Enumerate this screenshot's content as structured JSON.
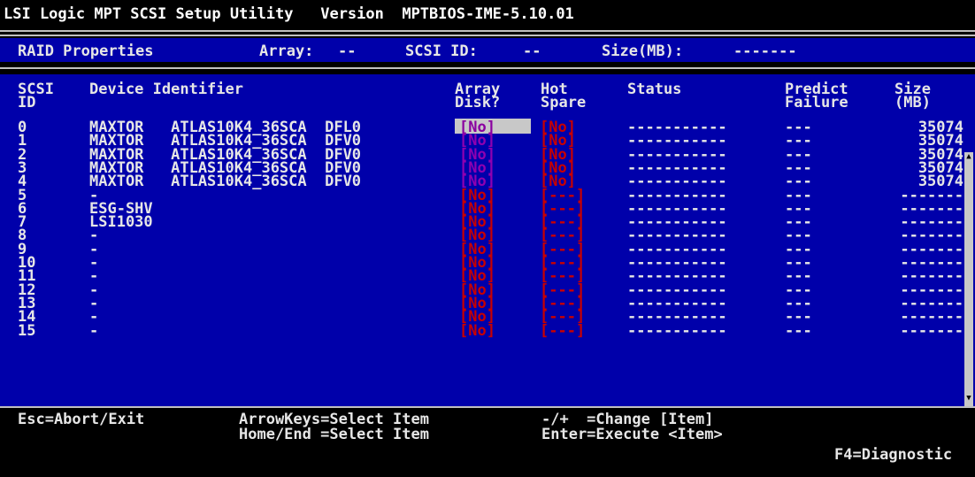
{
  "title": "LSI Logic MPT SCSI Setup Utility   Version  MPTBIOS-IME-5.10.01",
  "header": {
    "section": "RAID Properties",
    "array_label": "Array:",
    "array_value": "--",
    "scsi_id_label": "SCSI ID:",
    "scsi_id_value": "--",
    "size_label": "Size(MB):",
    "size_value": "-------"
  },
  "columns": {
    "scsi_id": [
      "SCSI",
      "ID"
    ],
    "device": [
      "Device Identifier",
      ""
    ],
    "array_disk": [
      "Array",
      "Disk?"
    ],
    "hot_spare": [
      "Hot",
      "Spare"
    ],
    "status": [
      "Status",
      ""
    ],
    "predict": [
      "Predict",
      "Failure"
    ],
    "size": [
      "Size",
      "(MB)"
    ]
  },
  "rows": [
    {
      "id": "0",
      "device": "MAXTOR   ATLAS10K4_36SCA  DFL0",
      "array": "[No]",
      "hot": "[No]",
      "status": "-----------",
      "predict": "---",
      "size": "35074",
      "selected": true
    },
    {
      "id": "1",
      "device": "MAXTOR   ATLAS10K4_36SCA  DFV0",
      "array": "[No]",
      "hot": "[No]",
      "status": "-----------",
      "predict": "---",
      "size": "35074"
    },
    {
      "id": "2",
      "device": "MAXTOR   ATLAS10K4_36SCA  DFV0",
      "array": "[No]",
      "hot": "[No]",
      "status": "-----------",
      "predict": "---",
      "size": "35074"
    },
    {
      "id": "3",
      "device": "MAXTOR   ATLAS10K4_36SCA  DFV0",
      "array": "[No]",
      "hot": "[No]",
      "status": "-----------",
      "predict": "---",
      "size": "35074"
    },
    {
      "id": "4",
      "device": "MAXTOR   ATLAS10K4_36SCA  DFV0",
      "array": "[No]",
      "hot": "[No]",
      "status": "-----------",
      "predict": "---",
      "size": "35074"
    },
    {
      "id": "5",
      "device": "-",
      "array": "[No]",
      "hot": "[---]",
      "status": "-----------",
      "predict": "---",
      "size": "-------"
    },
    {
      "id": "6",
      "device": "ESG-SHV",
      "array": "[No]",
      "hot": "[---]",
      "status": "-----------",
      "predict": "---",
      "size": "-------"
    },
    {
      "id": "7",
      "device": "LSI1030",
      "array": "[No]",
      "hot": "[---]",
      "status": "-----------",
      "predict": "---",
      "size": "-------"
    },
    {
      "id": "8",
      "device": "-",
      "array": "[No]",
      "hot": "[---]",
      "status": "-----------",
      "predict": "---",
      "size": "-------"
    },
    {
      "id": "9",
      "device": "-",
      "array": "[No]",
      "hot": "[---]",
      "status": "-----------",
      "predict": "---",
      "size": "-------"
    },
    {
      "id": "10",
      "device": "-",
      "array": "[No]",
      "hot": "[---]",
      "status": "-----------",
      "predict": "---",
      "size": "-------"
    },
    {
      "id": "11",
      "device": "-",
      "array": "[No]",
      "hot": "[---]",
      "status": "-----------",
      "predict": "---",
      "size": "-------"
    },
    {
      "id": "12",
      "device": "-",
      "array": "[No]",
      "hot": "[---]",
      "status": "-----------",
      "predict": "---",
      "size": "-------"
    },
    {
      "id": "13",
      "device": "-",
      "array": "[No]",
      "hot": "[---]",
      "status": "-----------",
      "predict": "---",
      "size": "-------"
    },
    {
      "id": "14",
      "device": "-",
      "array": "[No]",
      "hot": "[---]",
      "status": "-----------",
      "predict": "---",
      "size": "-------"
    },
    {
      "id": "15",
      "device": "-",
      "array": "[No]",
      "hot": "[---]",
      "status": "-----------",
      "predict": "---",
      "size": "-------"
    }
  ],
  "footer": {
    "esc": "Esc=Abort/Exit",
    "arrow": "ArrowKeys=Select Item",
    "home": "Home/End =Select Item",
    "change": "-/+  =Change [Item]",
    "enter": "Enter=Execute <Item>",
    "f4": "F4=Diagnostic"
  },
  "colors": {
    "background": "#0000aa",
    "text": "#e6e6e6",
    "selection": "#c8c8c8",
    "value": "#c80000"
  }
}
